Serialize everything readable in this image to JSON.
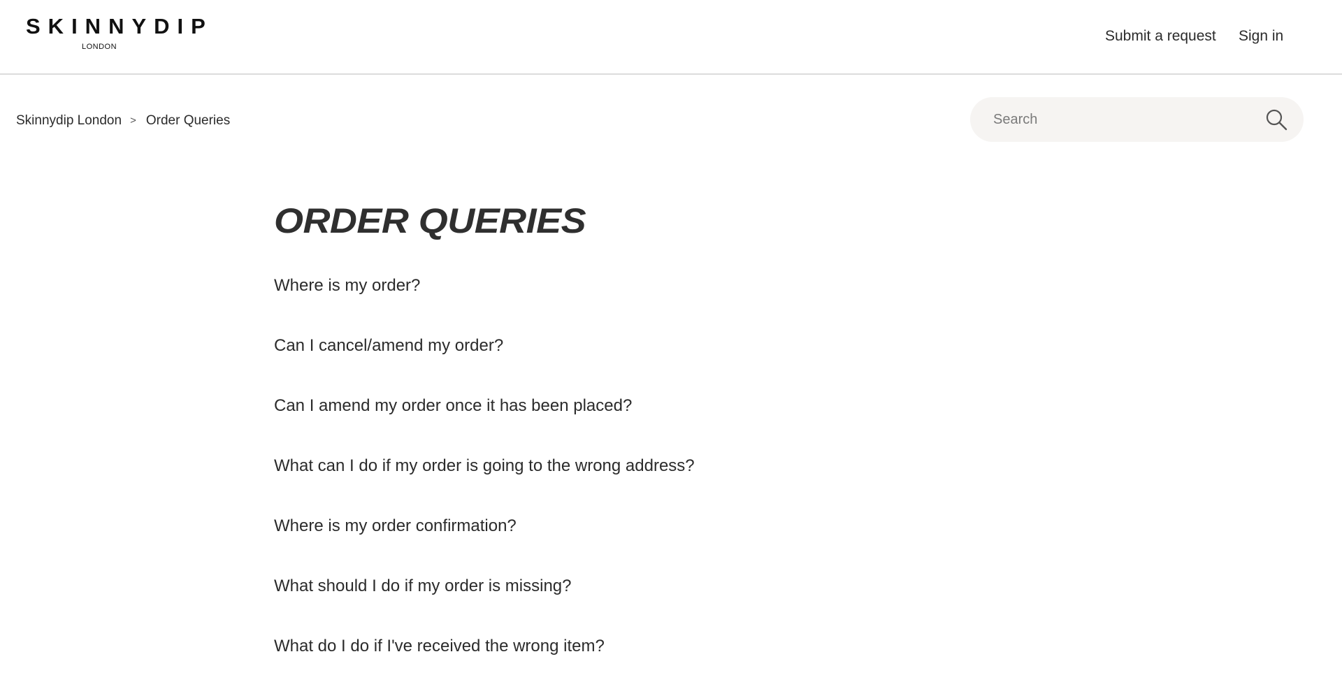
{
  "header": {
    "logo_main": "SKINNYDIP",
    "logo_sub": "LONDON",
    "nav": {
      "submit_request": "Submit a request",
      "sign_in": "Sign in"
    }
  },
  "breadcrumb": {
    "items": [
      "Skinnydip London",
      "Order Queries"
    ],
    "separator": ">"
  },
  "search": {
    "placeholder": "Search"
  },
  "main": {
    "title": "ORDER QUERIES",
    "articles": [
      "Where is my order?",
      "Can I cancel/amend my order?",
      "Can I amend my order once it has been placed?",
      "What can I do if my order is going to the wrong address?",
      "Where is my order confirmation?",
      "What should I do if my order is missing?",
      "What do I do if I've received the wrong item?"
    ]
  }
}
